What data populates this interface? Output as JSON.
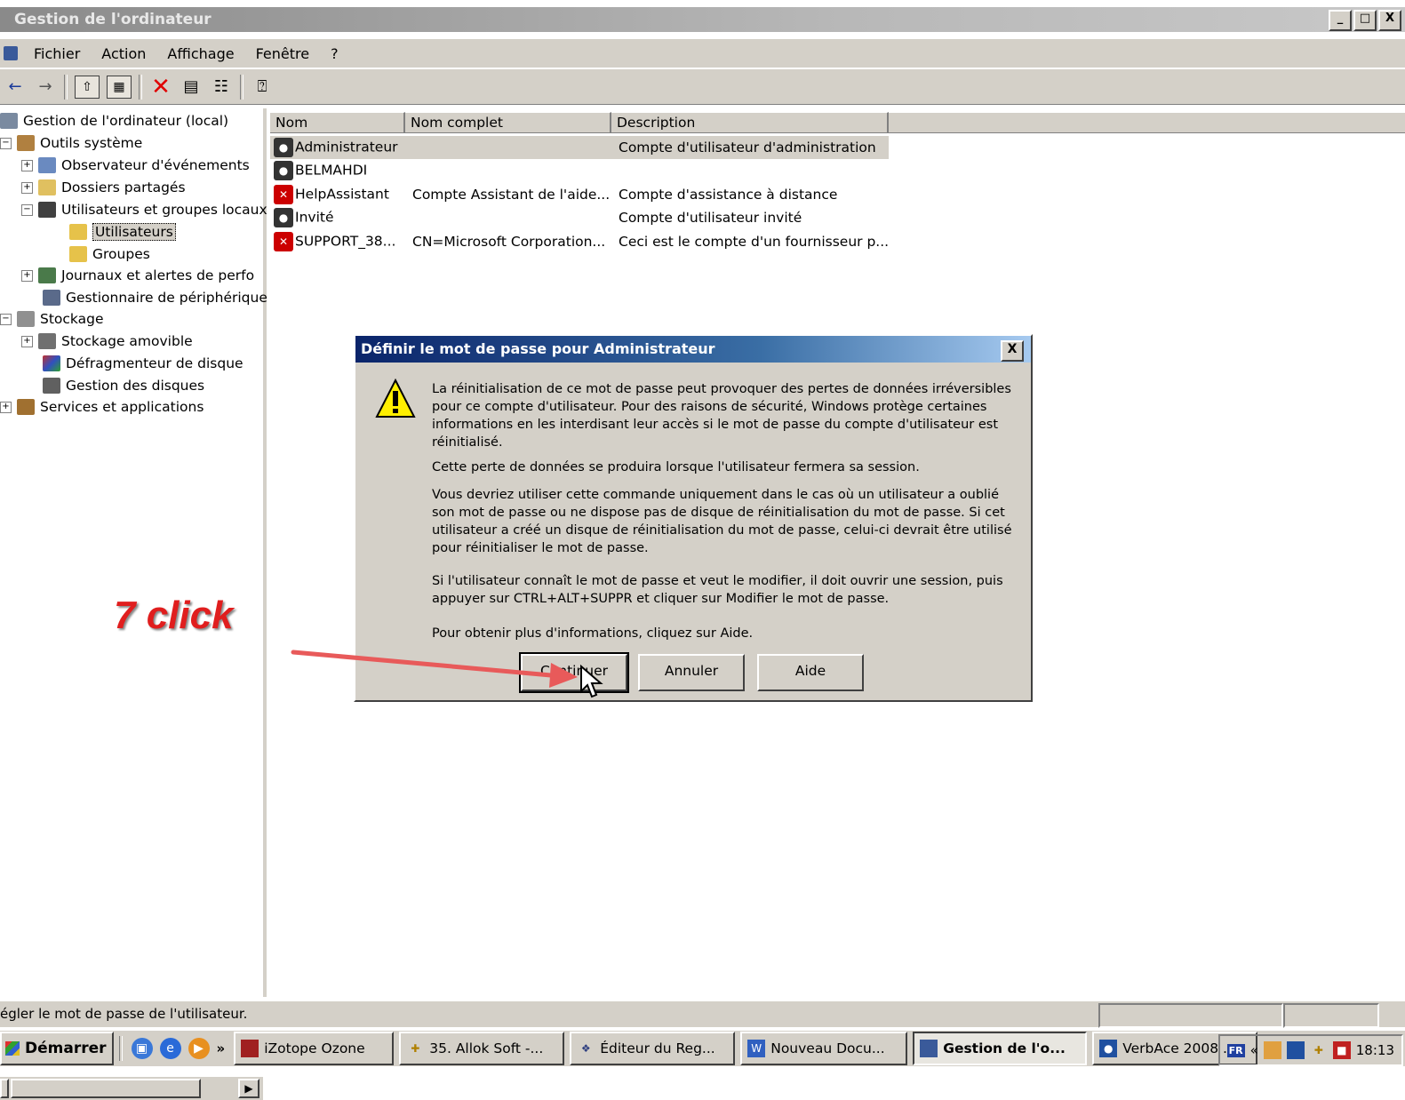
{
  "window": {
    "title": "Gestion de l'ordinateur",
    "controls": [
      "_",
      "□",
      "X"
    ]
  },
  "menu": [
    "Fichier",
    "Action",
    "Affichage",
    "Fenêtre",
    "?"
  ],
  "toolbar_icons": [
    "back-arrow-icon",
    "forward-arrow-icon",
    "up-folder-icon",
    "show-hide-tree-icon",
    "delete-icon",
    "properties-icon",
    "export-list-icon",
    "help-icon"
  ],
  "tree": {
    "root": "Gestion de l'ordinateur (local)",
    "items": [
      {
        "label": "Outils système",
        "level": 1
      },
      {
        "label": "Observateur d'événements",
        "level": 2
      },
      {
        "label": "Dossiers partagés",
        "level": 2
      },
      {
        "label": "Utilisateurs et groupes locaux",
        "level": 2
      },
      {
        "label": "Utilisateurs",
        "level": 3
      },
      {
        "label": "Groupes",
        "level": 3
      },
      {
        "label": "Journaux et alertes de perfo",
        "level": 2
      },
      {
        "label": "Gestionnaire de périphérique",
        "level": 2
      },
      {
        "label": "Stockage",
        "level": 1
      },
      {
        "label": "Stockage amovible",
        "level": 2
      },
      {
        "label": "Défragmenteur de disque",
        "level": 2
      },
      {
        "label": "Gestion des disques",
        "level": 2
      },
      {
        "label": "Services et applications",
        "level": 1
      }
    ]
  },
  "list": {
    "columns": [
      "Nom",
      "Nom complet",
      "Description"
    ],
    "rows": [
      {
        "nom": "Administrateur",
        "complet": "",
        "description": "Compte d'utilisateur d'administration",
        "selected": true
      },
      {
        "nom": "BELMAHDI",
        "complet": "",
        "description": ""
      },
      {
        "nom": "HelpAssistant",
        "complet": "Compte Assistant de l'aide...",
        "description": "Compte d'assistance à distance",
        "disabled": true
      },
      {
        "nom": "Invité",
        "complet": "",
        "description": "Compte d'utilisateur invité"
      },
      {
        "nom": "SUPPORT_38...",
        "complet": "CN=Microsoft Corporation...",
        "description": "Ceci est le compte d'un fournisseur p...",
        "disabled": true
      }
    ]
  },
  "dialog": {
    "title": "Définir le mot de passe pour Administrateur",
    "close": "X",
    "paragraphs": [
      "La réinitialisation de ce mot de passe peut provoquer des pertes de données irréversibles pour ce compte d'utilisateur. Pour des raisons de sécurité, Windows protège certaines informations en les interdisant leur accès si le mot de passe du compte d'utilisateur est réinitialisé.",
      "Cette perte de données se produira lorsque l'utilisateur fermera sa session.",
      "Vous devriez utiliser cette commande uniquement dans le cas où un utilisateur a oublié son mot de passe ou ne dispose pas de disque de réinitialisation du mot de passe. Si cet utilisateur a créé un disque de réinitialisation du mot de passe, celui-ci devrait être utilisé pour réinitialiser le mot de passe.",
      "Si l'utilisateur connaît le mot de passe et veut le modifier, il doit ouvrir une session, puis appuyer sur CTRL+ALT+SUPPR et cliquer sur Modifier le mot de passe.",
      "Pour obtenir plus d'informations, cliquez sur Aide."
    ],
    "buttons": {
      "continue": "Continuer",
      "cancel": "Annuler",
      "help": "Aide"
    }
  },
  "annotation": {
    "label": "7 click",
    "color": "#e01e1e"
  },
  "status_text": "égler le mot de passe de l'utilisateur.",
  "taskbar": {
    "start": "Démarrer",
    "more": "»",
    "tasks": [
      {
        "label": "iZotope Ozone",
        "active": false
      },
      {
        "label": "35. Allok Soft -...",
        "active": false
      },
      {
        "label": "Éditeur du Reg...",
        "active": false
      },
      {
        "label": "Nouveau Docu...",
        "active": false
      },
      {
        "label": "Gestion de l'o...",
        "active": true
      },
      {
        "label": "VerbAce 2008 ...",
        "active": false
      }
    ],
    "lang": "FR",
    "tray_arrow": "«",
    "clock": "18:13"
  },
  "colors": {
    "titlebar_active": "#0a246a",
    "face": "#d4d0c8",
    "annotation": "#e01e1e"
  }
}
